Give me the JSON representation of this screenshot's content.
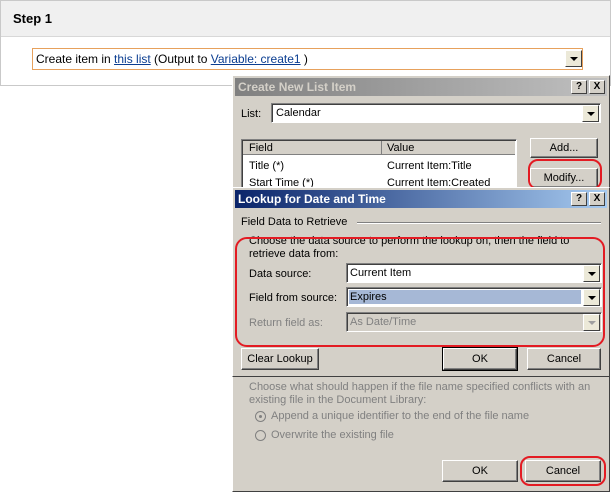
{
  "step": {
    "title": "Step 1",
    "action": {
      "prefix": "Create item in ",
      "link": "this list",
      "middle": " (Output to ",
      "variable": "Variable: create1",
      "suffix": " )"
    }
  },
  "create_dialog": {
    "title": "Create New List Item",
    "help": "?",
    "close": "X",
    "list_label": "List:",
    "list_value": "Calendar",
    "columns": [
      "Field",
      "Value"
    ],
    "rows": [
      {
        "field": "Title (*)",
        "value": "Current Item:Title"
      },
      {
        "field": "Start Time (*)",
        "value": "Current Item:Created"
      }
    ],
    "add_button": "Add...",
    "modify_button": "Modify...",
    "conflict_text": "Choose what should happen if the file name specified conflicts with an existing file in the Document Library:",
    "radio_append": "Append a unique identifier to the end of the file name",
    "radio_overwrite": "Overwrite the existing file",
    "ok_button": "OK",
    "cancel_button": "Cancel"
  },
  "lookup_dialog": {
    "title": "Lookup for Date and Time",
    "help": "?",
    "close": "X",
    "group_label": "Field Data to Retrieve",
    "description": "Choose the data source to perform the lookup on, then the field to retrieve data from:",
    "data_source_label": "Data source:",
    "data_source_value": "Current Item",
    "field_label": "Field from source:",
    "field_value": "Expires",
    "return_label": "Return field as:",
    "return_value": "As Date/Time",
    "clear_button": "Clear Lookup",
    "ok_button": "OK",
    "cancel_button": "Cancel"
  },
  "colors": {
    "highlight": "#e31b23",
    "selected_item": "#a6b8d6",
    "title_active": "#0a246a"
  }
}
